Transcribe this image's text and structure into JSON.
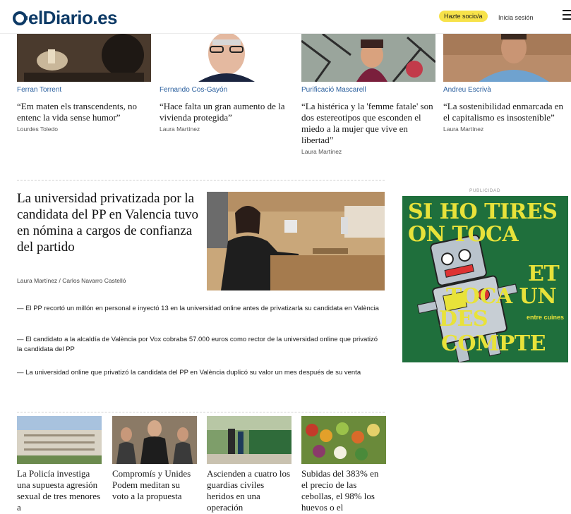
{
  "header": {
    "logo": "elDiario.es",
    "subscribe_label": "Hazte socio/a",
    "login_label": "Inicia sesión"
  },
  "top_stories": [
    {
      "author": "Ferran Torrent",
      "quote": "“Em maten els transcendents, no entenc la vida sense humor”",
      "byline": "Lourdes Toledo"
    },
    {
      "author": "Fernando Cos-Gayón",
      "quote": "“Hace falta un gran aumento de la vivienda protegida”",
      "byline": "Laura Martínez"
    },
    {
      "author": "Purificació Mascarell",
      "quote": "“La histérica y la 'femme fatale' son dos estereotipos que esconden el miedo a la mujer que vive en libertad”",
      "byline": "Laura Martínez"
    },
    {
      "author": "Andreu Escrivà",
      "quote": "“La sostenibilidad enmarcada en el capitalismo es insostenible”",
      "byline": "Laura Martínez"
    }
  ],
  "main_story": {
    "title": "La universidad privatizada por la candidata del PP en Valencia tuvo en nómina a cargos de confianza del partido",
    "byline": "Laura Martínez / Carlos Navarro Castelló",
    "related": [
      "— El PP recortó un millón en personal e inyectó 13 en la universidad online antes de privatizarla su candidata en València",
      "— El candidato a la alcaldía de València por Vox cobraba 57.000 euros como rector de la universidad online que privatizó la candidata del PP",
      "— La universidad online que privatizó la candidata del PP en València duplicó su valor un mes después de su venta"
    ]
  },
  "ad": {
    "label": "PUBLICIDAD",
    "line1": "SI HO TIRES",
    "line2": "ON TOCA",
    "line3": "ET",
    "line4": "TOCA UN",
    "line5": "DES",
    "line6": "COMPTE",
    "brand": "entre cuines",
    "colors": {
      "bg": "#1f6f3c",
      "text": "#e8e23a"
    }
  },
  "bottom_stories": [
    {
      "title": "La Policía investiga una supuesta agresión sexual de tres menores a"
    },
    {
      "title": "Compromís y Unides Podem meditan su voto a la propuesta"
    },
    {
      "title": "Ascienden a cuatro los guardias civiles heridos en una operación"
    },
    {
      "title": "Subidas del 383% en el precio de las cebollas, el 98% los huevos o el"
    }
  ],
  "colors": {
    "brand": "#0d3a66",
    "author_link": "#2a5f9e",
    "subscribe_bg": "#f7e24a"
  }
}
